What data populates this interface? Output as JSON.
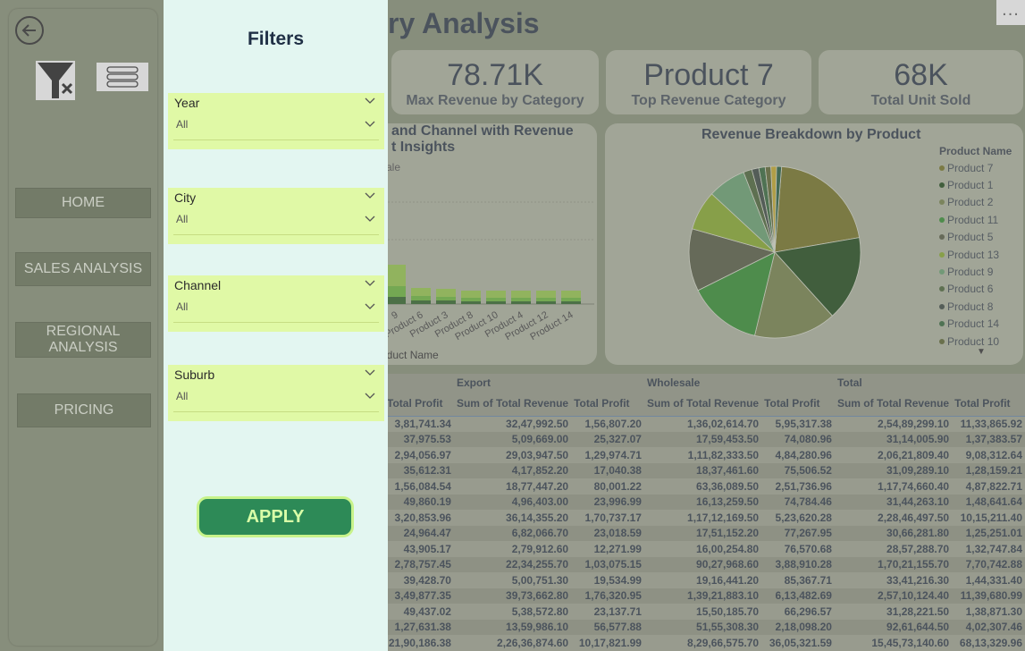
{
  "page": {
    "title_visible": "ry Analysis",
    "more_options": "..."
  },
  "kpis": [
    {
      "value": "78.71K",
      "label": "Max Revenue by Category"
    },
    {
      "value": "Product 7",
      "label": "Top Revenue Category"
    },
    {
      "value": "68K",
      "label": "Total Unit Sold"
    }
  ],
  "bar_card": {
    "title_line1": "and Channel with Revenue",
    "title_line2": "t Insights",
    "legend_fragment": "ale",
    "x_axis_label": "oduct Name",
    "x_labels": [
      "9",
      "Product 6",
      "Product 3",
      "Product 8",
      "Product 10",
      "Product 4",
      "Product 12",
      "Product 14"
    ]
  },
  "chart_data": {
    "type": "pie",
    "title": "Revenue Breakdown by Product",
    "legend_title": "Product Name",
    "labels": [
      "Product 7",
      "Product 1",
      "Product 2",
      "Product 11",
      "Product 5",
      "Product 13",
      "Product 9",
      "Product 6",
      "Product 8",
      "Product 14",
      "Product 10"
    ],
    "values": [
      78.71,
      60.0,
      58.0,
      52.0,
      44.0,
      28.0,
      27.0,
      6.0,
      5.0,
      4.5,
      4.0,
      4.0,
      3.5
    ],
    "colors": [
      "#6b6a12",
      "#0d3d07",
      "#6b7a3a",
      "#23861f",
      "#4a4f34",
      "#7fa51a",
      "#5d9c64",
      "#3d5a28",
      "#2c3b32",
      "#245c2a",
      "#4e5a20",
      "#c2a417",
      "#12502d"
    ],
    "legend_colors": [
      "#6b6a12",
      "#0d3d07",
      "#6b7a3a",
      "#23861f",
      "#4a4f34",
      "#7fa51a",
      "#5d9c64",
      "#3d5a28",
      "#2c3b32",
      "#245c2a",
      "#4e5a20"
    ],
    "legend_position": "right"
  },
  "table": {
    "group_headers": [
      "",
      "Export",
      "",
      "Wholesale",
      "",
      "Total",
      ""
    ],
    "columns": [
      "Total Profit",
      "Sum of Total Revenue",
      "Total Profit",
      "Sum of Total Revenue",
      "Total Profit",
      "Sum of Total Revenue",
      "Total Profit"
    ],
    "rows": [
      [
        "3,81,741.34",
        "32,47,992.50",
        "1,56,807.20",
        "1,36,02,614.70",
        "5,95,317.38",
        "2,54,89,299.10",
        "11,33,865.92"
      ],
      [
        "37,975.53",
        "5,09,669.00",
        "25,327.07",
        "17,59,453.50",
        "74,080.96",
        "31,14,005.90",
        "1,37,383.57"
      ],
      [
        "2,94,056.97",
        "29,03,947.50",
        "1,29,974.71",
        "1,11,82,333.50",
        "4,84,280.96",
        "2,06,21,809.40",
        "9,08,312.64"
      ],
      [
        "35,612.31",
        "4,17,852.20",
        "17,040.38",
        "18,37,461.60",
        "75,506.52",
        "31,09,289.10",
        "1,28,159.21"
      ],
      [
        "1,56,084.54",
        "18,77,447.20",
        "80,001.22",
        "63,36,089.50",
        "2,51,736.96",
        "1,17,74,660.40",
        "4,87,822.71"
      ],
      [
        "49,860.19",
        "4,96,403.00",
        "23,996.99",
        "16,13,259.50",
        "74,784.46",
        "31,44,263.10",
        "1,48,641.64"
      ],
      [
        "3,20,853.96",
        "36,14,355.20",
        "1,70,737.17",
        "1,17,12,169.50",
        "5,23,620.28",
        "2,28,46,497.50",
        "10,15,211.40"
      ],
      [
        "24,964.47",
        "6,82,066.70",
        "23,018.59",
        "17,51,152.20",
        "77,267.95",
        "30,66,281.80",
        "1,25,251.01"
      ],
      [
        "43,905.17",
        "2,79,912.60",
        "12,271.99",
        "16,00,254.80",
        "76,570.68",
        "28,57,288.70",
        "1,32,747.84"
      ],
      [
        "2,78,757.45",
        "22,34,255.70",
        "1,03,075.15",
        "90,27,968.60",
        "3,88,910.28",
        "1,70,21,155.70",
        "7,70,742.88"
      ],
      [
        "39,428.70",
        "5,00,751.30",
        "19,534.99",
        "19,16,441.20",
        "85,367.71",
        "33,41,216.30",
        "1,44,331.40"
      ],
      [
        "3,49,877.35",
        "39,73,662.80",
        "1,76,320.95",
        "1,39,21,883.10",
        "6,13,482.69",
        "2,57,10,124.40",
        "11,39,680.99"
      ],
      [
        "49,437.02",
        "5,38,572.80",
        "23,137.71",
        "15,50,185.70",
        "66,296.57",
        "31,28,221.50",
        "1,38,871.30"
      ],
      [
        "1,27,631.38",
        "13,59,986.10",
        "56,577.88",
        "51,55,308.30",
        "2,18,098.20",
        "92,61,644.50",
        "4,02,307.46"
      ],
      [
        "21,90,186.38",
        "2,26,36,874.60",
        "10,17,821.99",
        "8,29,66,575.70",
        "36,05,321.59",
        "15,45,73,140.60",
        "68,13,329.96"
      ]
    ]
  },
  "nav": {
    "home": "HOME",
    "sales_analysis": "SALES ANALYSIS",
    "regional_line1": "REGIONAL",
    "regional_line2": "ANALYSIS",
    "pricing": "PRICING"
  },
  "filters": {
    "title": "Filters",
    "slicers": [
      {
        "label": "Year",
        "value": "All"
      },
      {
        "label": "City",
        "value": "All"
      },
      {
        "label": "Channel",
        "value": "All"
      },
      {
        "label": "Suburb",
        "value": "All"
      }
    ],
    "apply_label": "APPLY"
  }
}
